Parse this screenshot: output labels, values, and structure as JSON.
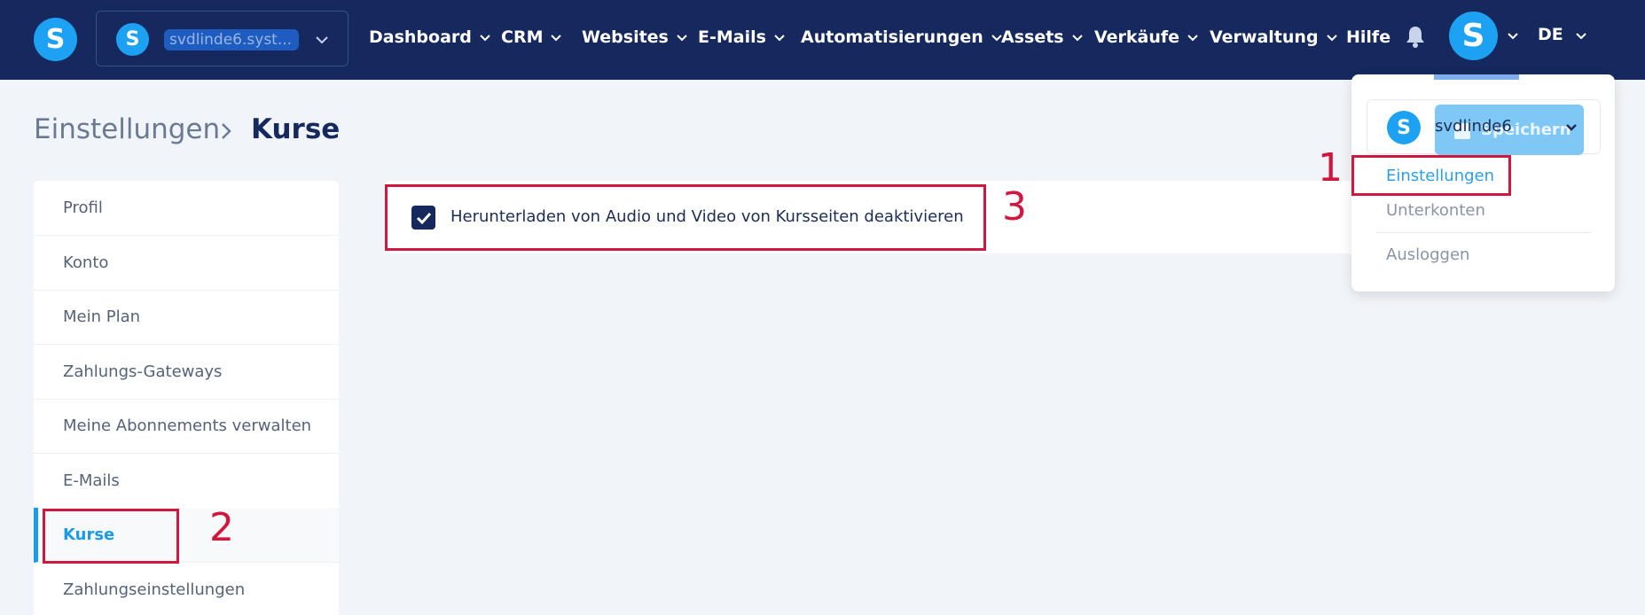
{
  "topbar": {
    "logo_letter": "S",
    "site": {
      "logo_letter": "S",
      "name": "svdlinde6.syst..."
    },
    "nav": [
      {
        "label": "Dashboard"
      },
      {
        "label": "CRM"
      },
      {
        "label": "Websites"
      },
      {
        "label": "E-Mails"
      },
      {
        "label": "Automatisierungen"
      },
      {
        "label": "Assets"
      },
      {
        "label": "Verkäufe"
      },
      {
        "label": "Verwaltung"
      }
    ],
    "help_label": "Hilfe",
    "user_logo_letter": "S",
    "language": "DE"
  },
  "breadcrumb": {
    "parent": "Einstellungen",
    "current": "Kurse"
  },
  "sidebar": {
    "items": [
      {
        "label": "Profil"
      },
      {
        "label": "Konto"
      },
      {
        "label": "Mein Plan"
      },
      {
        "label": "Zahlungs-Gateways"
      },
      {
        "label": "Meine Abonnements verwalten"
      },
      {
        "label": "E-Mails"
      },
      {
        "label": "Kurse",
        "active": true
      },
      {
        "label": "Zahlungseinstellungen"
      }
    ]
  },
  "main": {
    "checkbox": {
      "label": "Herunterladen von Audio und Video von Kursseiten deaktivieren",
      "checked": true
    }
  },
  "dropdown": {
    "account": {
      "logo_letter": "S",
      "name": "svdlinde6"
    },
    "save_label": "Speichern",
    "items": [
      {
        "label": "Einstellungen",
        "active": true
      },
      {
        "label": "Unterkonten"
      },
      {
        "label": "Ausloggen"
      }
    ]
  },
  "annotations": [
    "1",
    "2",
    "3"
  ],
  "colors": {
    "nav_bg": "#16295e",
    "accent": "#1a9be8",
    "annotation": "#d0173d",
    "page_bg": "#f1f4f8"
  }
}
